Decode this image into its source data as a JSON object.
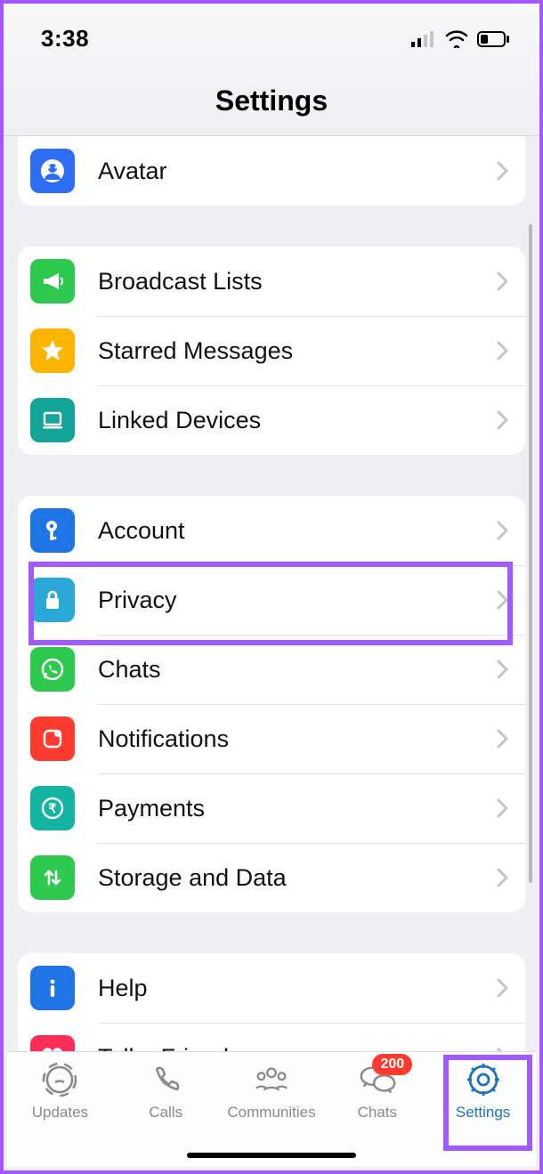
{
  "status": {
    "time": "3:38"
  },
  "header": {
    "title": "Settings"
  },
  "group0": {
    "avatar": "Avatar"
  },
  "group1": {
    "broadcast": "Broadcast Lists",
    "starred": "Starred Messages",
    "linked": "Linked Devices"
  },
  "group2": {
    "account": "Account",
    "privacy": "Privacy",
    "chats": "Chats",
    "notifications": "Notifications",
    "payments": "Payments",
    "storage": "Storage and Data"
  },
  "group3": {
    "help": "Help",
    "tell": "Tell a Friend"
  },
  "tabs": {
    "updates": "Updates",
    "calls": "Calls",
    "communities": "Communities",
    "chats": "Chats",
    "chats_badge": "200",
    "settings": "Settings"
  },
  "colors": {
    "avatar": "#2e6df6",
    "broadcast": "#2ec94f",
    "starred": "#ffb400",
    "linked": "#13a698",
    "account": "#1f74e6",
    "privacy": "#2aa8d8",
    "chats": "#2ec94f",
    "notifications": "#ff3b30",
    "payments": "#13b5a2",
    "storage": "#2ec94f",
    "help": "#1f74e6",
    "tell": "#ff2d55",
    "active": "#1f74c0",
    "highlight": "#a259ff"
  }
}
